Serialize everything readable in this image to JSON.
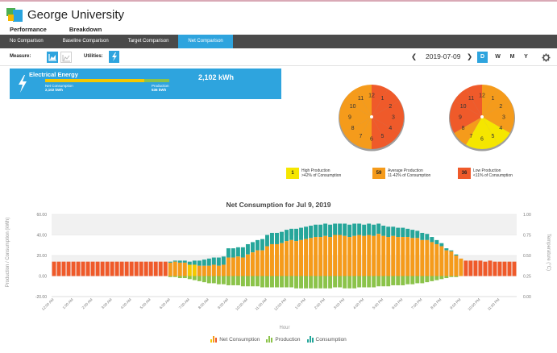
{
  "app": {
    "name": "George University"
  },
  "tabs": [
    {
      "label": "Performance",
      "active": true
    },
    {
      "label": "Breakdown",
      "active": false
    }
  ],
  "subnav": [
    {
      "label": "No Comparison",
      "active": false
    },
    {
      "label": "Baseline Comparison",
      "active": false
    },
    {
      "label": "Target Comparison",
      "active": false
    },
    {
      "label": "Net Comparison",
      "active": true
    }
  ],
  "toolbar": {
    "measure_label": "Measure:",
    "utilities_label": "Utilities:",
    "date": "2019-07-09",
    "prev_icon": "chevron-left-icon",
    "next_icon": "chevron-right-icon",
    "periods": [
      "D",
      "W",
      "M",
      "Y"
    ],
    "active_period": "D",
    "settings_icon": "gear-icon"
  },
  "energy": {
    "title": "Electrical Energy",
    "net_consumption_label": "Net Consumption",
    "net_consumption_value": "2,102 kWh",
    "production_label": "Production",
    "production_value": "536 kWh",
    "total": "2,102 kWh",
    "icon": "lightning-bolt-icon",
    "consumption_fraction": 0.8
  },
  "clocks": [
    {
      "name": "am",
      "center": "12",
      "numbers": [
        "12",
        "1",
        "2",
        "3",
        "4",
        "5",
        "6",
        "7",
        "8",
        "9",
        "10",
        "11"
      ],
      "levels": [
        "L",
        "L",
        "L",
        "L",
        "L",
        "L",
        "A",
        "A",
        "A",
        "A",
        "A",
        "A"
      ]
    },
    {
      "name": "pm",
      "center": "12",
      "numbers": [
        "12",
        "1",
        "2",
        "3",
        "4",
        "5",
        "6",
        "7",
        "8",
        "9",
        "10",
        "11"
      ],
      "levels": [
        "A",
        "A",
        "A",
        "A",
        "H",
        "H",
        "H",
        "A",
        "L",
        "L",
        "L",
        "L"
      ]
    }
  ],
  "legend": [
    {
      "count": "1",
      "title": "High Production",
      "desc": ">42% of Consumption",
      "color": "#f5e600"
    },
    {
      "count": "59",
      "title": "Average Production",
      "desc": "11-42% of Consumption",
      "color": "#f59b1b"
    },
    {
      "count": "36",
      "title": "Low Production",
      "desc": "<11% of Consumption",
      "color": "#ef5a2a"
    }
  ],
  "chart_title": "Net Consumption for Jul 9, 2019",
  "chart_data": {
    "type": "bar",
    "title": "Net Consumption for Jul 9, 2019",
    "xlabel": "Hour",
    "ylabel": "Production / Consumption (kWh)",
    "y2label": "Temperature (°C)",
    "ylim": [
      -20,
      60
    ],
    "yticks": [
      "60.00",
      "40.00",
      "20.00",
      "0.00",
      "-20.00"
    ],
    "y2ticks": [
      "1.00",
      "0.75",
      "0.50",
      "0.25",
      "0.00"
    ],
    "xticks": [
      "12:00 AM",
      "1:00 AM",
      "2:00 AM",
      "3:00 AM",
      "4:00 AM",
      "5:00 AM",
      "6:00 AM",
      "7:00 AM",
      "8:00 AM",
      "9:00 AM",
      "10:00 AM",
      "11:00 AM",
      "12:00 PM",
      "1:00 PM",
      "2:00 PM",
      "3:00 PM",
      "4:00 PM",
      "5:00 PM",
      "6:00 PM",
      "7:00 PM",
      "8:00 PM",
      "9:00 PM",
      "10:00 PM",
      "11:00 PM"
    ],
    "interval_minutes": 15,
    "legend": [
      "Net Consumption",
      "Production",
      "Consumption"
    ],
    "colors": {
      "Net Consumption": "#f59b1b",
      "Net Consumption (low)": "#ef5a2a",
      "Production": "#8bc34a",
      "Consumption": "#26a69a"
    },
    "series": [
      {
        "name": "Consumption",
        "values": [
          14,
          14,
          14,
          14,
          14,
          14,
          14,
          14,
          14,
          14,
          14,
          14,
          14,
          14,
          14,
          14,
          14,
          14,
          14,
          14,
          14,
          14,
          14,
          14,
          14,
          15,
          15,
          15,
          14,
          15,
          15,
          16,
          17,
          18,
          18,
          19,
          27,
          27,
          28,
          28,
          31,
          33,
          35,
          36,
          40,
          42,
          42,
          43,
          45,
          46,
          46,
          47,
          48,
          49,
          50,
          50,
          51,
          50,
          51,
          51,
          51,
          50,
          51,
          51,
          50,
          51,
          50,
          51,
          49,
          48,
          48,
          47,
          47,
          46,
          45,
          44,
          42,
          41,
          38,
          35,
          32,
          27,
          25,
          21,
          17,
          15,
          15,
          15,
          15,
          14,
          15,
          14,
          14,
          14,
          14,
          14
        ]
      },
      {
        "name": "Production",
        "values": [
          0,
          0,
          0,
          0,
          0,
          0,
          0,
          0,
          0,
          0,
          0,
          0,
          0,
          0,
          0,
          0,
          0,
          0,
          0,
          0,
          0,
          0,
          0,
          0,
          -1,
          -1,
          -2,
          -2,
          -3,
          -4,
          -5,
          -6,
          -7,
          -7,
          -8,
          -8,
          -9,
          -9,
          -9,
          -10,
          -10,
          -10,
          -10,
          -11,
          -11,
          -11,
          -11,
          -11,
          -11,
          -11,
          -12,
          -12,
          -12,
          -12,
          -12,
          -12,
          -12,
          -12,
          -11,
          -11,
          -12,
          -12,
          -12,
          -11,
          -11,
          -11,
          -11,
          -10,
          -10,
          -10,
          -9,
          -9,
          -9,
          -8,
          -8,
          -7,
          -7,
          -6,
          -5,
          -4,
          -3,
          -2,
          -1,
          -1,
          0,
          0,
          0,
          0,
          0,
          0,
          0,
          0,
          0,
          0,
          0,
          0
        ]
      },
      {
        "name": "Net Consumption",
        "values": [
          14,
          14,
          14,
          14,
          14,
          14,
          14,
          14,
          14,
          14,
          14,
          14,
          14,
          14,
          14,
          14,
          14,
          14,
          14,
          14,
          14,
          14,
          14,
          14,
          13,
          14,
          13,
          13,
          11,
          11,
          10,
          10,
          10,
          11,
          10,
          11,
          18,
          18,
          19,
          18,
          21,
          23,
          25,
          25,
          29,
          31,
          31,
          32,
          34,
          35,
          34,
          35,
          36,
          37,
          38,
          38,
          39,
          38,
          40,
          40,
          39,
          38,
          39,
          40,
          39,
          40,
          39,
          41,
          39,
          38,
          39,
          38,
          38,
          38,
          37,
          37,
          35,
          35,
          33,
          31,
          29,
          25,
          24,
          20,
          17,
          15,
          15,
          15,
          15,
          14,
          15,
          14,
          14,
          14,
          14,
          14
        ]
      }
    ]
  }
}
